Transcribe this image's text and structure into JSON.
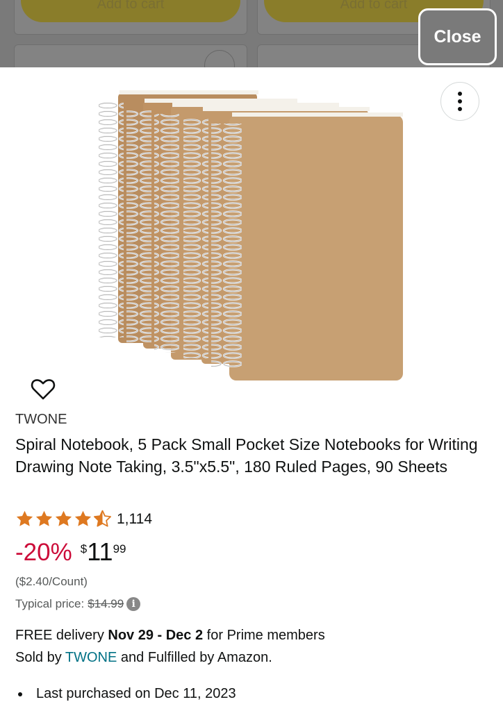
{
  "backdrop": {
    "add_to_cart_left": "Add to cart",
    "add_to_cart_right": "Add to cart",
    "close_label": "Close"
  },
  "product": {
    "brand": "TWONE",
    "title": "Spiral Notebook, 5 Pack Small Pocket Size Notebooks for Writing Drawing Note Taking, 3.5\"x5.5\", 180 Ruled Pages, 90 Sheets",
    "rating_stars": 4.5,
    "rating_count": "1,114",
    "discount": "-20%",
    "price_currency": "$",
    "price_whole": "11",
    "price_fraction": "99",
    "unit_price": "($2.40/Count)",
    "typical_price_label": "Typical price:",
    "typical_price": "$14.99",
    "info_icon": "i",
    "delivery_prefix": "FREE delivery ",
    "delivery_dates": "Nov 29 - Dec 2",
    "delivery_suffix": " for Prime members",
    "sold_by_prefix": "Sold by ",
    "seller": "TWONE",
    "sold_by_suffix": " and Fulfilled by Amazon.",
    "last_purchased": "Last purchased on Dec 11, 2023"
  },
  "colors": {
    "star": "#de7921",
    "discount": "#cc0c39",
    "link": "#007185",
    "kraft": "#c49a6c"
  },
  "icons": {
    "more": "more-vertical-icon",
    "wishlist": "heart-icon",
    "info": "info-icon"
  }
}
